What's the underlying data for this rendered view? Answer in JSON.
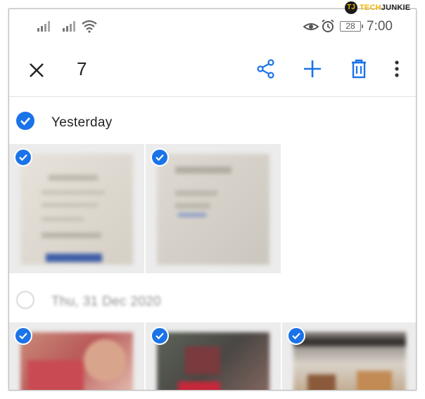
{
  "status_bar": {
    "icons": [
      "signal-icon",
      "signal-icon",
      "wifi-icon",
      "eye-comfort-icon",
      "alarm-icon"
    ],
    "battery_level": "28",
    "time": "7:00"
  },
  "watermark": {
    "logo_text": "TJ",
    "brand_part1": "TECH",
    "brand_part2": "JUNKIE"
  },
  "action_bar": {
    "close_icon": "close-icon",
    "selected_count": "7",
    "actions": [
      "share-icon",
      "add-icon",
      "delete-icon",
      "more-vert-icon"
    ],
    "accent_color": "#1a73e8"
  },
  "sections": [
    {
      "title": "Yesterday",
      "selected": true,
      "photos": [
        {
          "selected": true
        },
        {
          "selected": true
        }
      ]
    },
    {
      "title": "Thu, 31 Dec 2020",
      "selected": false,
      "photos": [
        {
          "selected": true
        },
        {
          "selected": true
        },
        {
          "selected": true
        }
      ]
    }
  ]
}
